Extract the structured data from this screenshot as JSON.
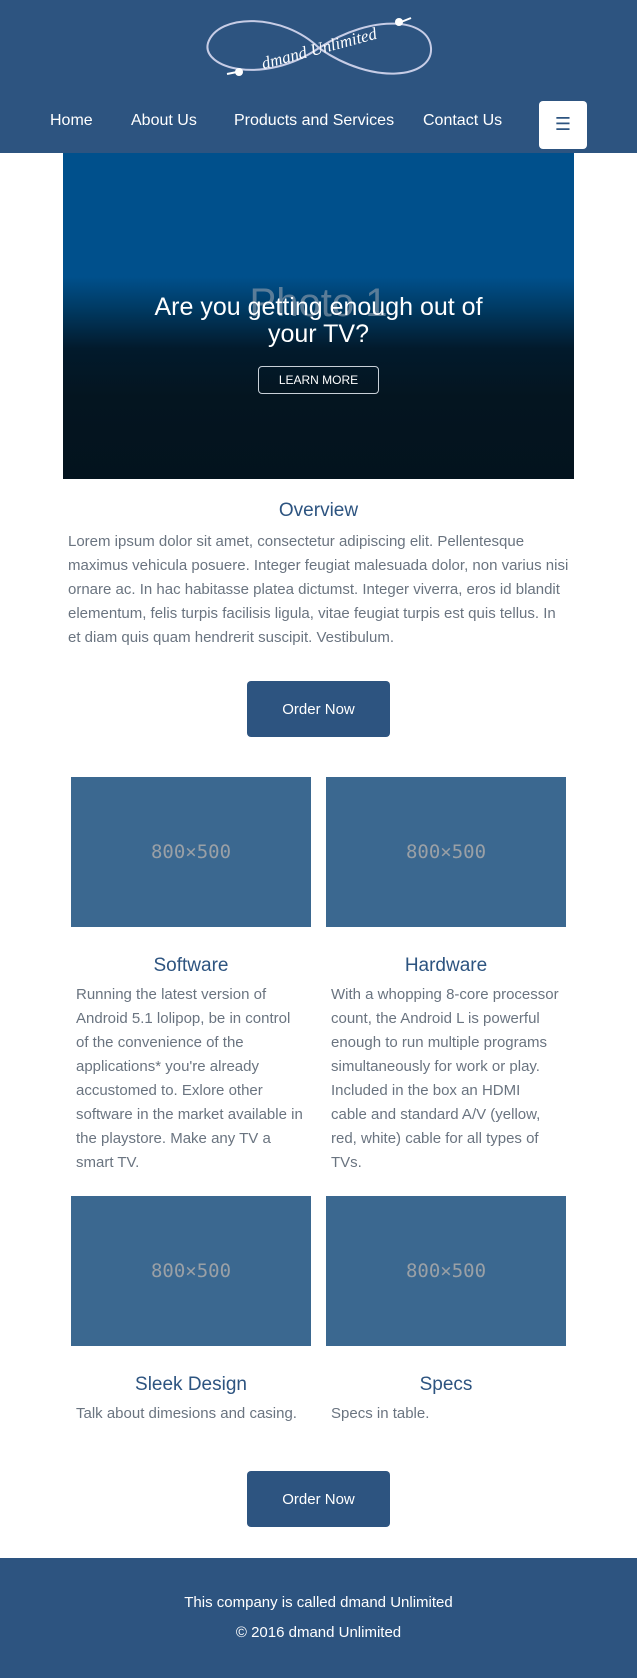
{
  "header": {
    "logo_text": "dmand Unlimited",
    "nav": [
      {
        "label": "Home"
      },
      {
        "label": "About Us"
      },
      {
        "label": "Products and Services"
      },
      {
        "label": "Contact Us"
      }
    ],
    "menu_icon": "hamburger-icon",
    "menu_glyph": "☰"
  },
  "hero": {
    "photo_label": "Photo 1",
    "heading": "Are you getting enough out of your TV?",
    "button_label": "LEARN MORE"
  },
  "overview": {
    "title": "Overview",
    "text": "Lorem ipsum dolor sit amet, consectetur adipiscing elit. Pellentesque maximus vehicula posuere. Integer feugiat malesuada dolor, non varius nisi ornare ac. In hac habitasse platea dictumst. Integer viverra, eros id blandit elementum, felis turpis facilisis ligula, vitae feugiat turpis est quis tellus. In et diam quis quam hendrerit suscipit. Vestibulum."
  },
  "order_button_label": "Order Now",
  "features": [
    {
      "image_label": "800×500",
      "title": "Software",
      "text": "Running the latest version of Android 5.1 lolipop, be in control of the convenience of the applications* you're already accustomed to. Exlore other software in the market available in the playstore. Make any TV a smart TV."
    },
    {
      "image_label": "800×500",
      "title": "Hardware",
      "text": "With a whopping 8-core processor count, the Android L is powerful enough to run multiple programs simultaneously for work or play. Included in the box an HDMI cable and standard A/V (yellow, red, white) cable for all types of TVs."
    },
    {
      "image_label": "800×500",
      "title": "Sleek Design",
      "text": "Talk about dimesions and casing."
    },
    {
      "image_label": "800×500",
      "title": "Specs",
      "text": "Specs in table."
    }
  ],
  "footer": {
    "line1": "This company is called dmand Unlimited",
    "line2": "© 2016 dmand Unlimited"
  },
  "colors": {
    "brand": "#2d5480",
    "placeholder": "#3b6890",
    "body_text": "#6a7480"
  }
}
